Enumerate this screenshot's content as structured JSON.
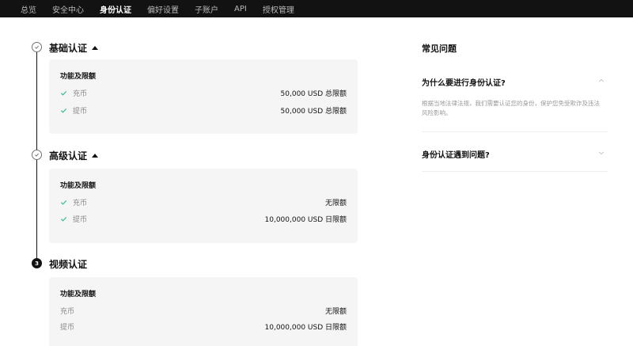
{
  "nav": {
    "items": [
      "总览",
      "安全中心",
      "身份认证",
      "偏好设置",
      "子账户",
      "API",
      "授权管理"
    ],
    "active_index": 2
  },
  "steps": [
    {
      "title": "基础认证",
      "status": "completed",
      "card_heading": "功能及限额",
      "rows": [
        {
          "label": "充币",
          "value": "50,000 USD 总限额",
          "checked": true
        },
        {
          "label": "提币",
          "value": "50,000 USD 总限额",
          "checked": true
        }
      ]
    },
    {
      "title": "高级认证",
      "status": "completed",
      "card_heading": "功能及限额",
      "rows": [
        {
          "label": "充币",
          "value": "无限额",
          "checked": true
        },
        {
          "label": "提币",
          "value": "10,000,000 USD 日限额",
          "checked": true
        }
      ]
    },
    {
      "title": "视频认证",
      "status": "pending",
      "number": "3",
      "card_heading": "功能及限额",
      "rows": [
        {
          "label": "充币",
          "value": "无限额",
          "checked": false
        },
        {
          "label": "提币",
          "value": "10,000,000 USD 日限额",
          "checked": false
        }
      ]
    }
  ],
  "faq": {
    "title": "常见问题",
    "items": [
      {
        "question": "为什么要进行身份认证?",
        "answer": "根据当地法律法规，我们需要认证您的身份，保护您免受欺诈及违法风险影响。",
        "expanded": true
      },
      {
        "question": "身份认证遇到问题?",
        "expanded": false
      }
    ]
  },
  "colors": {
    "nav_bg": "#121212",
    "check_green": "#2dbd85",
    "card_bg": "#f5f5f5"
  }
}
